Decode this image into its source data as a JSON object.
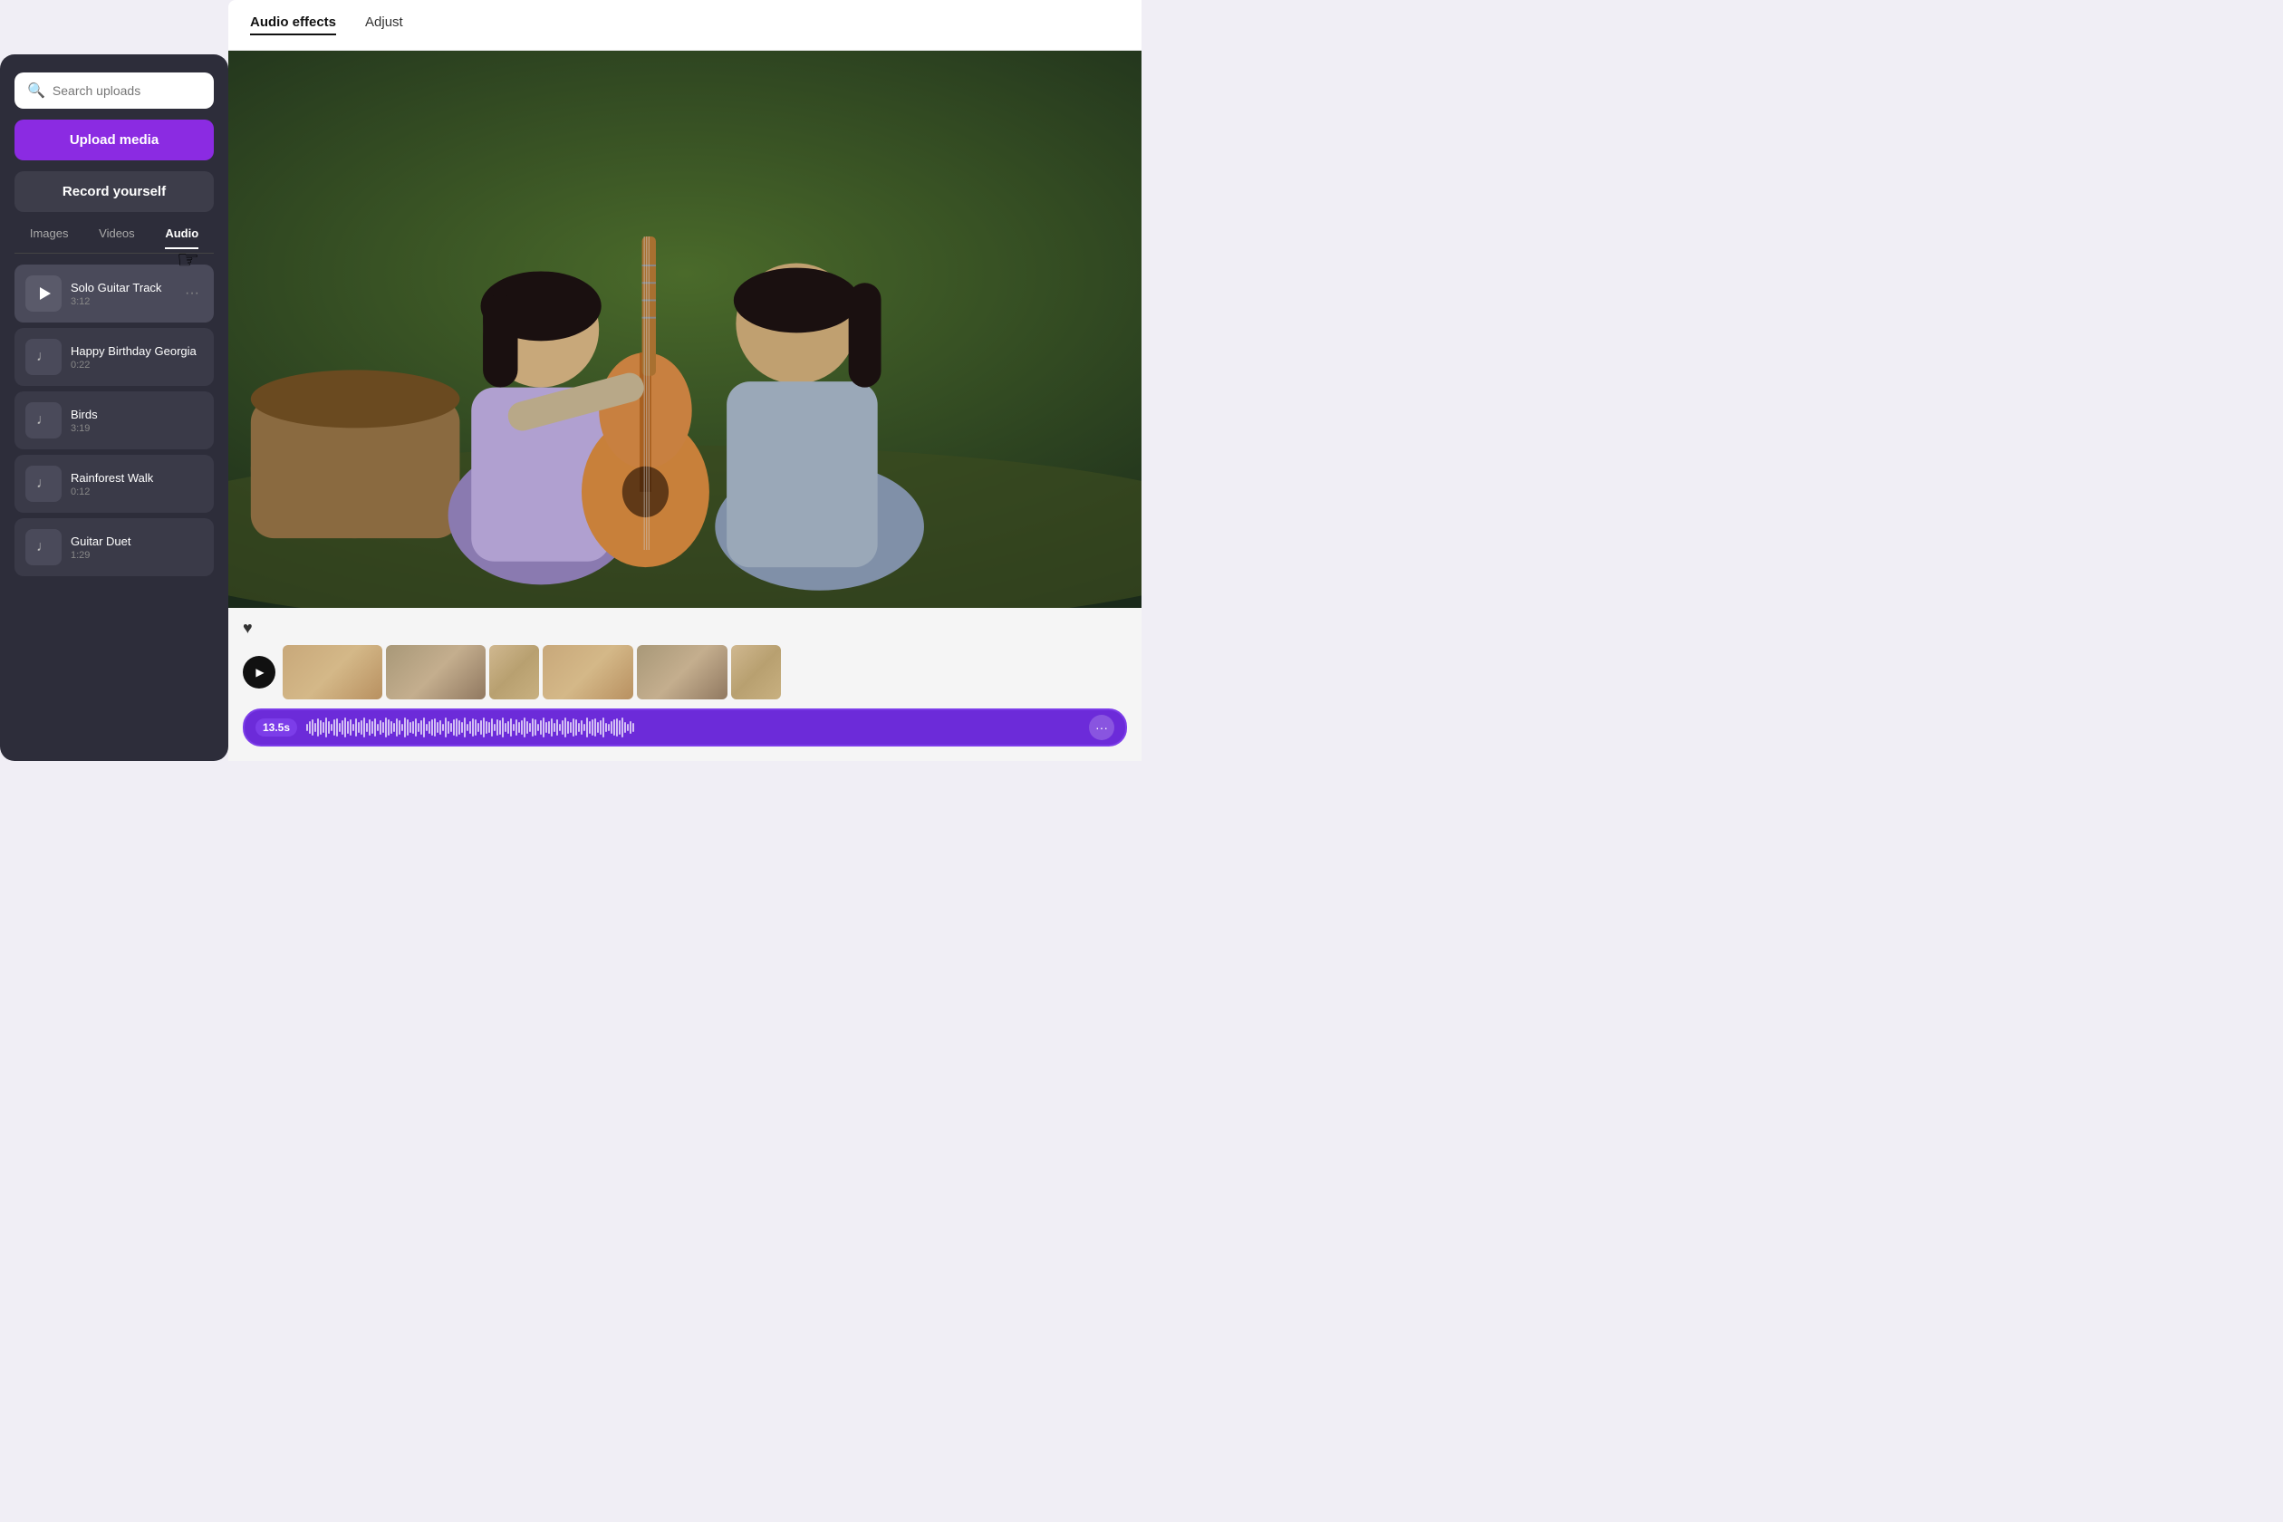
{
  "tabs": {
    "audio_effects": "Audio effects",
    "adjust": "Adjust",
    "active_tab": "audio_effects"
  },
  "search": {
    "placeholder": "Search uploads"
  },
  "buttons": {
    "upload_media": "Upload media",
    "record_yourself": "Record yourself"
  },
  "filter_tabs": [
    {
      "id": "images",
      "label": "Images",
      "active": false
    },
    {
      "id": "videos",
      "label": "Videos",
      "active": false
    },
    {
      "id": "audio",
      "label": "Audio",
      "active": true
    }
  ],
  "audio_items": [
    {
      "id": 1,
      "name": "Solo Guitar Track",
      "duration": "3:12",
      "active": true,
      "has_play": true
    },
    {
      "id": 2,
      "name": "Happy Birthday Georgia",
      "duration": "0:22",
      "active": false,
      "has_play": false
    },
    {
      "id": 3,
      "name": "Birds",
      "duration": "3:19",
      "active": false,
      "has_play": false
    },
    {
      "id": 4,
      "name": "Rainforest Walk",
      "duration": "0:12",
      "active": false,
      "has_play": false
    },
    {
      "id": 5,
      "name": "Guitar Duet",
      "duration": "1:29",
      "active": false,
      "has_play": false
    }
  ],
  "timeline": {
    "time_badge": "13.5s",
    "more_label": "···"
  },
  "colors": {
    "upload_btn": "#8b2be2",
    "record_btn": "#3d3d4a",
    "active_audio": "#6c2bd9",
    "panel_bg": "#2d2d3a"
  }
}
